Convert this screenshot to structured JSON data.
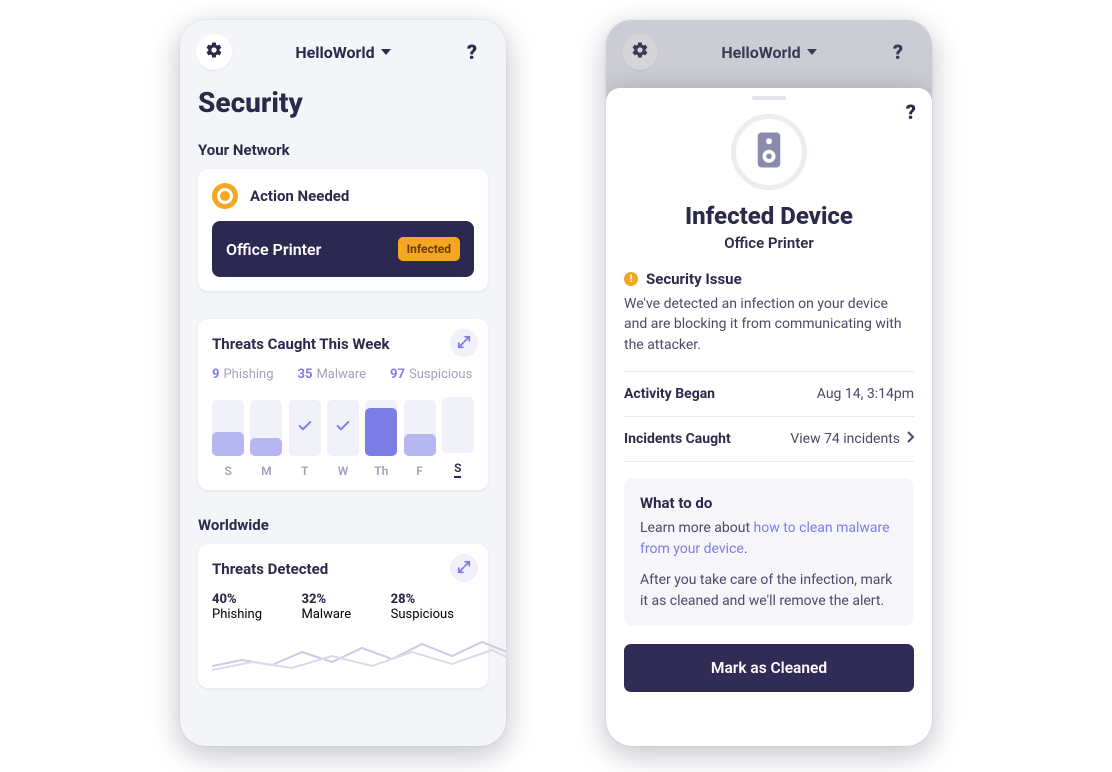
{
  "colors": {
    "accent": "#7B7EE6",
    "amber": "#F5A623",
    "darkTile": "#2C2950"
  },
  "header": {
    "network_name": "HelloWorld",
    "settings_icon": "gear-icon",
    "help_icon": "question-icon"
  },
  "screen1": {
    "title": "Security",
    "network": {
      "label": "Your Network",
      "action_needed": "Action Needed",
      "device": {
        "name": "Office Printer",
        "status": "Infected"
      }
    },
    "threats_week": {
      "title": "Threats Caught This Week",
      "totals": {
        "phishing": {
          "count": 9,
          "label": "Phishing"
        },
        "malware": {
          "count": 35,
          "label": "Malware"
        },
        "suspicious": {
          "count": 97,
          "label": "Suspicious"
        }
      }
    },
    "worldwide": {
      "label": "Worldwide",
      "title": "Threats Detected",
      "pct": {
        "phishing": {
          "value": "40%",
          "label": "Phishing"
        },
        "malware": {
          "value": "32%",
          "label": "Malware"
        },
        "suspicious": {
          "value": "28%",
          "label": "Suspicious"
        }
      }
    }
  },
  "chart_data": {
    "type": "bar",
    "title": "Threats Caught This Week",
    "categories": [
      "S",
      "M",
      "T",
      "W",
      "Th",
      "F",
      "S"
    ],
    "values": [
      24,
      18,
      0,
      0,
      48,
      22,
      0
    ],
    "ylim": [
      0,
      56
    ],
    "today_index": 6,
    "legend": [
      "Phishing",
      "Malware",
      "Suspicious"
    ],
    "totals": [
      9,
      35,
      97
    ]
  },
  "screen2": {
    "title": "Infected Device",
    "subtitle": "Office Printer",
    "issue_label": "Security Issue",
    "issue_body": "We've detected an infection on your device and are blocking it from communicating with the attacker.",
    "activity_began": {
      "label": "Activity Began",
      "value": "Aug 14, 3:14pm"
    },
    "incidents": {
      "label": "Incidents Caught",
      "link": "View 74 incidents"
    },
    "todo": {
      "title": "What to do",
      "learn_prefix": "Learn more about ",
      "learn_link": "how to clean malware from your device",
      "learn_suffix": ".",
      "after": "After you take care of the infection, mark it as cleaned and we'll remove the alert."
    },
    "cta": "Mark as Cleaned"
  }
}
